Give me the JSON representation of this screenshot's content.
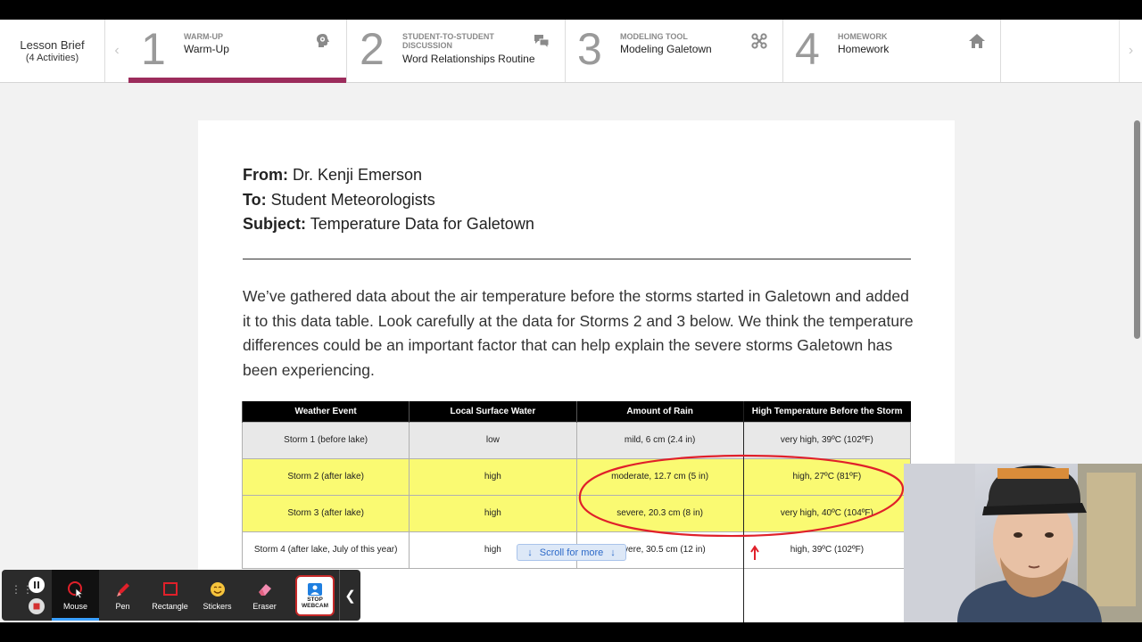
{
  "lesson_brief": {
    "title": "Lesson Brief",
    "subtitle": "(4 Activities)"
  },
  "tabs": [
    {
      "number": "1",
      "category": "WARM-UP",
      "title": "Warm-Up",
      "icon": "brain-icon",
      "active": true
    },
    {
      "number": "2",
      "category": "STUDENT-TO-STUDENT DISCUSSION",
      "title": "Word Relationships Routine",
      "icon": "chat-bubbles-icon",
      "active": false
    },
    {
      "number": "3",
      "category": "MODELING TOOL",
      "title": "Modeling Galetown",
      "icon": "nodes-icon",
      "active": false
    },
    {
      "number": "4",
      "category": "HOMEWORK",
      "title": "Homework",
      "icon": "home-icon",
      "active": false
    }
  ],
  "memo": {
    "from_label": "From:",
    "from_value": "Dr. Kenji Emerson",
    "to_label": "To:",
    "to_value": "Student Meteorologists",
    "subject_label": "Subject:",
    "subject_value": "Temperature Data for Galetown",
    "body": "We’ve gathered data about the air temperature before the storms started in Galetown and added it to this data table. Look carefully at the data for Storms 2 and 3 below. We think the temperature differences could be an important factor that can help explain the severe storms Galetown has been experiencing."
  },
  "table": {
    "headers": [
      "Weather Event",
      "Local Surface Water",
      "Amount of Rain",
      "High Temperature Before the Storm"
    ],
    "rows": [
      [
        "Storm 1 (before lake)",
        "low",
        "mild, 6 cm (2.4 in)",
        "very high, 39ºC (102ºF)"
      ],
      [
        "Storm 2 (after lake)",
        "high",
        "moderate, 12.7 cm (5 in)",
        "high, 27ºC (81ºF)"
      ],
      [
        "Storm 3 (after lake)",
        "high",
        "severe, 20.3 cm (8 in)",
        "very high, 40ºC (104ºF)"
      ],
      [
        "Storm 4 (after lake, July of this year)",
        "high",
        "severe, 30.5 cm (12 in)",
        "high, 39ºC (102ºF)"
      ]
    ],
    "highlight_color": "#fafa72"
  },
  "scroll_hint": "Scroll for more",
  "annotation_color": "#e0202a",
  "toolbar": {
    "tools": [
      {
        "label": "Mouse",
        "icon": "mouse-cursor-icon",
        "active": true
      },
      {
        "label": "Pen",
        "icon": "pen-icon",
        "active": false
      },
      {
        "label": "Rectangle",
        "icon": "rectangle-icon",
        "active": false
      },
      {
        "label": "Stickers",
        "icon": "sticker-emoji-icon",
        "active": false
      },
      {
        "label": "Eraser",
        "icon": "eraser-icon",
        "active": false
      }
    ],
    "webcam_label": "STOP WEBCAM"
  },
  "colors": {
    "active_tab_bar": "#9c2c5c",
    "toolbar_bg": "#2b2b2b"
  }
}
